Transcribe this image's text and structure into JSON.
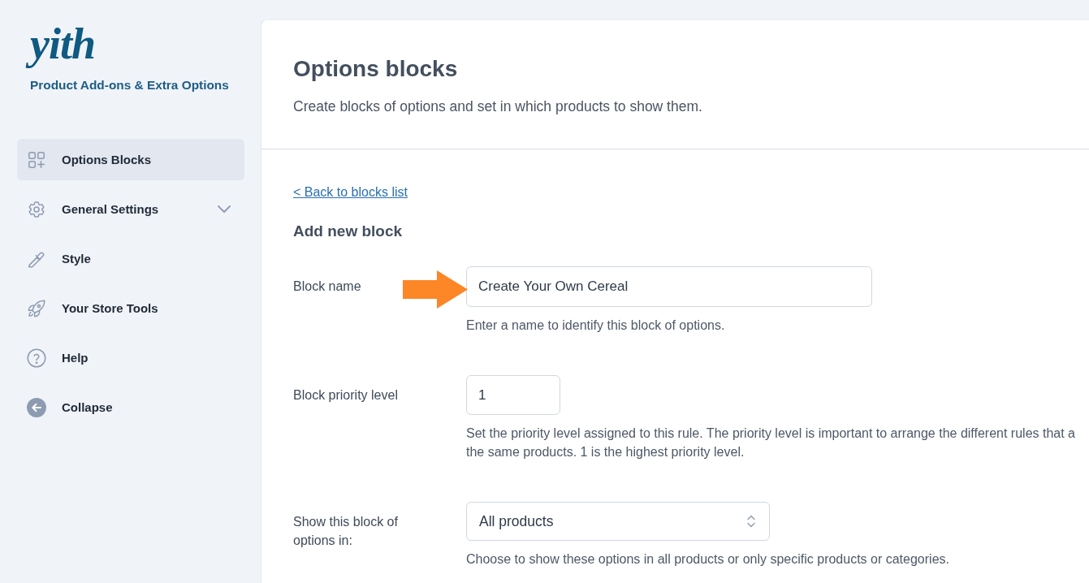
{
  "sidebar": {
    "logo": "yith",
    "plugin_name": "Product Add-ons & Extra Options",
    "items": [
      {
        "kind": "page",
        "label": "Options Blocks",
        "selected": true
      },
      {
        "kind": "group",
        "label": "General Settings",
        "selected": false,
        "expanded": false
      },
      {
        "kind": "page",
        "label": "Style",
        "selected": false
      },
      {
        "kind": "page",
        "label": "Your Store Tools",
        "selected": false
      },
      {
        "kind": "page",
        "label": "Help",
        "selected": false
      },
      {
        "kind": "action",
        "label": "Collapse",
        "selected": false
      }
    ]
  },
  "header": {
    "title": "Options blocks",
    "description": "Create blocks of options and set in which products to show them."
  },
  "back_link": "< Back to blocks list",
  "form": {
    "title": "Add new block",
    "fields": [
      {
        "kind": "text",
        "label": "Block name",
        "value": "Create Your Own Cereal",
        "help": "Enter a name to identify this block of options.",
        "pointed": true
      },
      {
        "kind": "number",
        "label": "Block priority level",
        "value": "1",
        "help": "Set the priority level assigned to this rule. The priority level is important to arrange the different rules that a\nthe same products. 1 is the highest priority level.",
        "pointed": false
      },
      {
        "kind": "select",
        "label": "Show this block of options in:",
        "value": "All products",
        "help": "Choose to show these options in all products or only specific products or categories.",
        "pointed": false
      }
    ]
  }
}
